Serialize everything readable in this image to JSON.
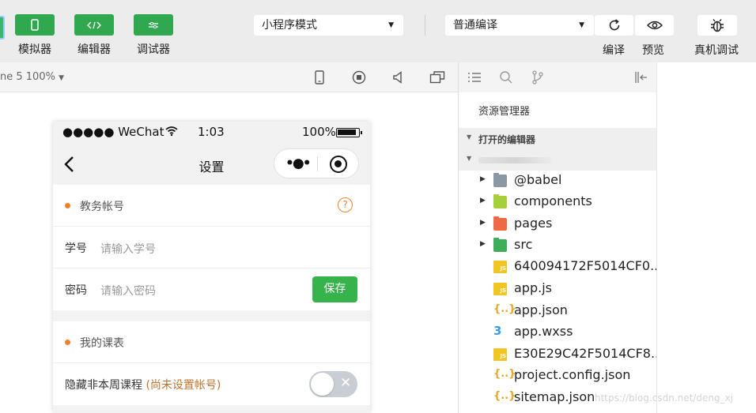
{
  "toolbar": {
    "simulator_label": "模拟器",
    "editor_label": "编辑器",
    "debugger_label": "调试器",
    "mode_select": "小程序模式",
    "compile_select": "普通编译",
    "compile_label": "编译",
    "preview_label": "预览",
    "device_debug_label": "真机调试"
  },
  "simulator": {
    "device_info": "ne 5 100%",
    "phone": {
      "status_left": "●●●●● WeChat",
      "status_time": "1:03",
      "status_battery": "100%",
      "nav_title": "设置",
      "account_section": "教务帐号",
      "student_id_label": "学号",
      "student_id_placeholder": "请输入学号",
      "password_label": "密码",
      "password_placeholder": "请输入密码",
      "save_label": "保存",
      "schedule_section": "我的课表",
      "hide_label": "隐藏非本周课程",
      "hide_hint": "(尚未设置帐号)",
      "toggle_state": false
    }
  },
  "explorer": {
    "title": "资源管理器",
    "open_editors": "打开的编辑器",
    "items": [
      {
        "name": "@babel",
        "type": "folder"
      },
      {
        "name": "components",
        "type": "folder"
      },
      {
        "name": "pages",
        "type": "folder"
      },
      {
        "name": "src",
        "type": "folder"
      },
      {
        "name": "640094172F5014CF0...",
        "type": "js"
      },
      {
        "name": "app.js",
        "type": "js"
      },
      {
        "name": "app.json",
        "type": "json"
      },
      {
        "name": "app.wxss",
        "type": "css"
      },
      {
        "name": "E30E29C42F5014CF8...",
        "type": "js"
      },
      {
        "name": "project.config.json",
        "type": "json"
      },
      {
        "name": "sitemap.json",
        "type": "json"
      }
    ]
  },
  "watermark": "https://blog.csdn.net/deng_xj",
  "colors": {
    "accent_green": "#2fa84f",
    "save_green": "#36b34a",
    "section_dot": "#f0802e",
    "hint_brown": "#b8752f"
  }
}
